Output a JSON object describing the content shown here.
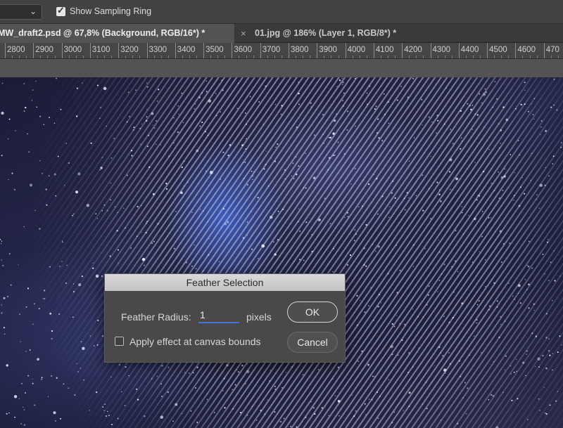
{
  "options_bar": {
    "sampling_ring_label": "Show Sampling Ring",
    "sampling_ring_checked": true,
    "check_glyph": "✓",
    "dropdown_chevron": "⌄"
  },
  "tabs": [
    {
      "label": "MW_draft2.psd @ 67,8% (Background, RGB/16*) *",
      "active": true
    },
    {
      "label": "01.jpg @ 186% (Layer 1, RGB/8*) *",
      "active": false,
      "close_glyph": "×"
    }
  ],
  "ruler": {
    "ticks": [
      "2800",
      "2900",
      "3000",
      "3100",
      "3200",
      "3300",
      "3400",
      "3500",
      "3600",
      "3700",
      "3800",
      "3900",
      "4000",
      "4100",
      "4200",
      "4300",
      "4400",
      "4500",
      "4600",
      "470"
    ]
  },
  "dialog": {
    "title": "Feather Selection",
    "radius_label": "Feather Radius:",
    "radius_value": "1",
    "units": "pixels",
    "canvas_bounds_label": "Apply effect at canvas bounds",
    "canvas_bounds_checked": false,
    "ok_label": "OK",
    "cancel_label": "Cancel"
  },
  "colors": {
    "accent": "#3f74d6",
    "panel": "#424242",
    "dialog": "#494949"
  }
}
